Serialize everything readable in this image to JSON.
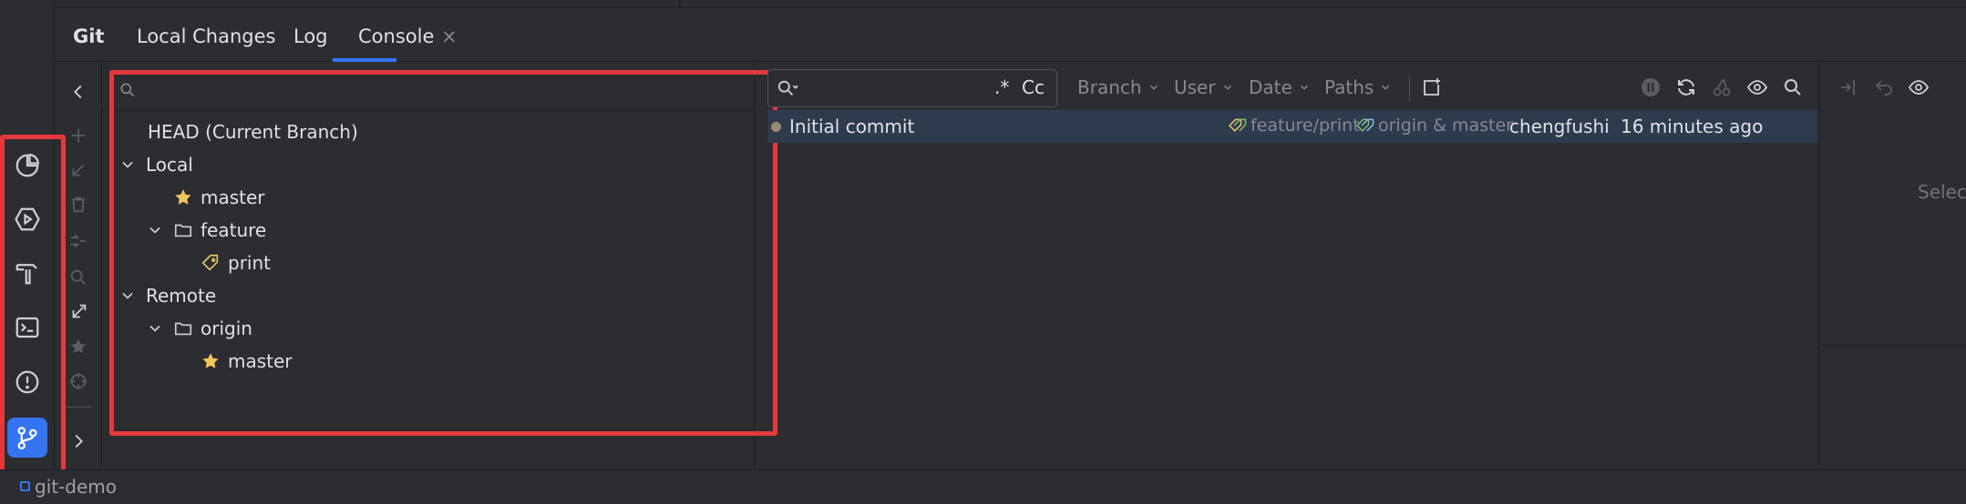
{
  "tabs": {
    "git": "Git",
    "local_changes": "Local Changes",
    "log": "Log",
    "console": "Console",
    "console_close": "×"
  },
  "left_strip": {
    "icons": [
      "pie-chart-icon",
      "run-services-icon",
      "build-hammer-icon",
      "terminal-icon",
      "problems-icon",
      "git-branch-icon"
    ],
    "active": "git-branch-icon"
  },
  "branches": {
    "search_placeholder": "",
    "head": "HEAD (Current Branch)",
    "local_label": "Local",
    "local_master": "master",
    "feature_folder": "feature",
    "feature_print": "print",
    "remote_label": "Remote",
    "origin_folder": "origin",
    "origin_master": "master"
  },
  "log": {
    "search_value": "",
    "regex_label": ".*",
    "case_label": "Cc",
    "filters": {
      "branch": "Branch",
      "user": "User",
      "date": "Date",
      "paths": "Paths"
    },
    "commit": {
      "message": "Initial commit",
      "ref_feature": "feature/print",
      "ref_origin": "origin & master",
      "author": "chengfushi",
      "time": "16 minutes ago"
    }
  },
  "right_panel": {
    "select_text": "Select"
  },
  "status": {
    "project": "git-demo"
  },
  "colors": {
    "accent": "#3574f0",
    "highlight_box": "#e5383b",
    "star": "#f2c55c",
    "tag": "#e8c46a",
    "ref_tag": "#7bbf6a",
    "commit_dot": "#9c8a6e"
  }
}
